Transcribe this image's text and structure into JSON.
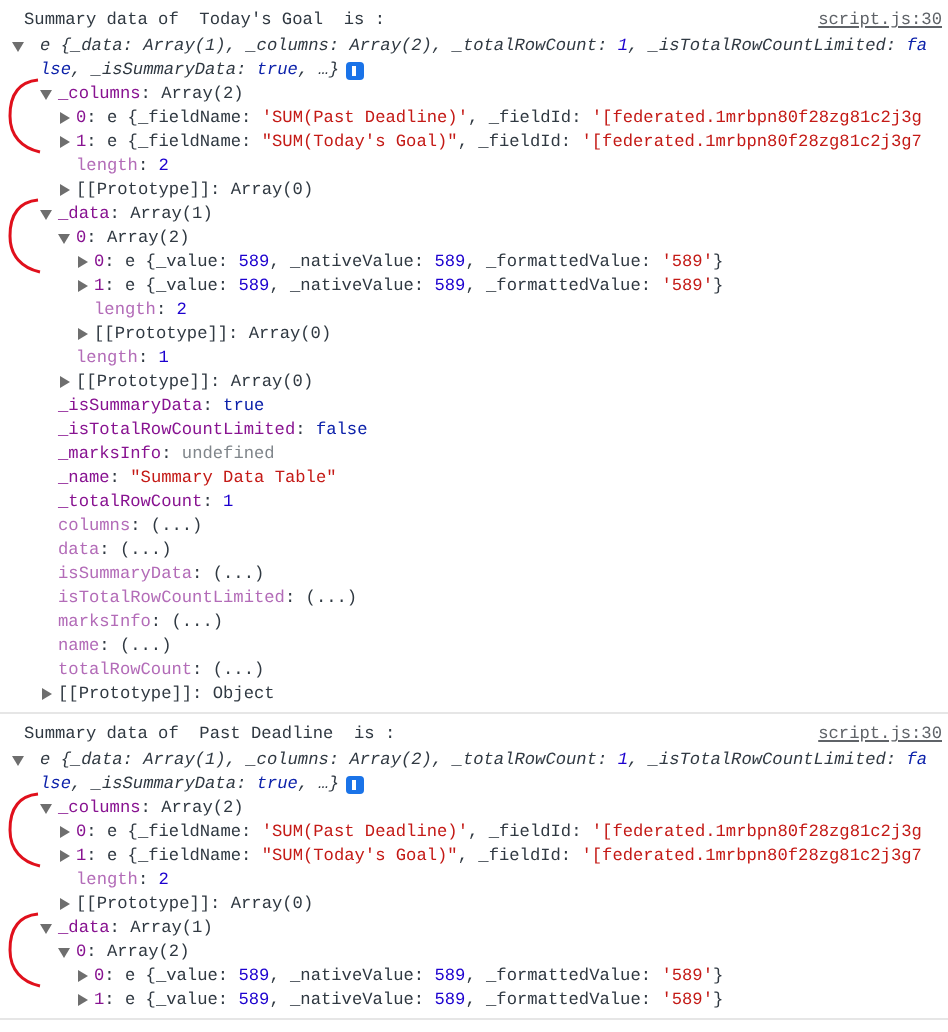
{
  "messages": [
    {
      "header": "Summary data of  Today's Goal  is :",
      "source": "script.js:30",
      "root": {
        "kind": "expandable",
        "expanded": true,
        "preview": true,
        "info_badge": true,
        "tokens": [
          {
            "kind": "text",
            "text": "e {_data: Array(1), _columns: Array(2), _totalRowCount: "
          },
          {
            "kind": "number",
            "text": "1"
          },
          {
            "kind": "text",
            "text": ", _isTotalRowCountLimited: "
          },
          {
            "kind": "keyword",
            "text": "fa"
          },
          {
            "kind": "break"
          },
          {
            "kind": "keyword",
            "text": "lse"
          },
          {
            "kind": "text",
            "text": ", _isSummaryData: "
          },
          {
            "kind": "keyword",
            "text": "true"
          },
          {
            "kind": "text",
            "text": ", …}"
          }
        ],
        "children": [
          {
            "kind": "expandable",
            "expanded": true,
            "annotated": true,
            "tokens": [
              {
                "kind": "key",
                "text": "_columns"
              },
              {
                "kind": "text",
                "text": ": Array(2)"
              }
            ],
            "children": [
              {
                "kind": "expandable",
                "expanded": false,
                "tokens": [
                  {
                    "kind": "key",
                    "text": "0"
                  },
                  {
                    "kind": "text",
                    "text": ": e {_fieldName: "
                  },
                  {
                    "kind": "string",
                    "text": "'SUM(Past Deadline)'"
                  },
                  {
                    "kind": "text",
                    "text": ", _fieldId: "
                  },
                  {
                    "kind": "string",
                    "text": "'[federated.1mrbpn80f28zg81c2j3g"
                  }
                ]
              },
              {
                "kind": "expandable",
                "expanded": false,
                "tokens": [
                  {
                    "kind": "key",
                    "text": "1"
                  },
                  {
                    "kind": "text",
                    "text": ": e {_fieldName: "
                  },
                  {
                    "kind": "string",
                    "text": "\"SUM(Today's Goal)\""
                  },
                  {
                    "kind": "text",
                    "text": ", _fieldId: "
                  },
                  {
                    "kind": "string",
                    "text": "'[federated.1mrbpn80f28zg81c2j3g7"
                  }
                ]
              },
              {
                "kind": "leaf",
                "tokens": [
                  {
                    "kind": "faint-key",
                    "text": "length"
                  },
                  {
                    "kind": "text",
                    "text": ": "
                  },
                  {
                    "kind": "number",
                    "text": "2"
                  }
                ]
              },
              {
                "kind": "expandable",
                "expanded": false,
                "tokens": [
                  {
                    "kind": "text",
                    "text": "[[Prototype]]: Array(0)"
                  }
                ]
              }
            ]
          },
          {
            "kind": "expandable",
            "expanded": true,
            "annotated": true,
            "tokens": [
              {
                "kind": "key",
                "text": "_data"
              },
              {
                "kind": "text",
                "text": ": Array(1)"
              }
            ],
            "children": [
              {
                "kind": "expandable",
                "expanded": true,
                "tokens": [
                  {
                    "kind": "key",
                    "text": "0"
                  },
                  {
                    "kind": "text",
                    "text": ": Array(2)"
                  }
                ],
                "children": [
                  {
                    "kind": "expandable",
                    "expanded": false,
                    "tokens": [
                      {
                        "kind": "key",
                        "text": "0"
                      },
                      {
                        "kind": "text",
                        "text": ": e {_value: "
                      },
                      {
                        "kind": "number",
                        "text": "589"
                      },
                      {
                        "kind": "text",
                        "text": ", _nativeValue: "
                      },
                      {
                        "kind": "number",
                        "text": "589"
                      },
                      {
                        "kind": "text",
                        "text": ", _formattedValue: "
                      },
                      {
                        "kind": "string",
                        "text": "'589'"
                      },
                      {
                        "kind": "text",
                        "text": "}"
                      }
                    ]
                  },
                  {
                    "kind": "expandable",
                    "expanded": false,
                    "tokens": [
                      {
                        "kind": "key",
                        "text": "1"
                      },
                      {
                        "kind": "text",
                        "text": ": e {_value: "
                      },
                      {
                        "kind": "number",
                        "text": "589"
                      },
                      {
                        "kind": "text",
                        "text": ", _nativeValue: "
                      },
                      {
                        "kind": "number",
                        "text": "589"
                      },
                      {
                        "kind": "text",
                        "text": ", _formattedValue: "
                      },
                      {
                        "kind": "string",
                        "text": "'589'"
                      },
                      {
                        "kind": "text",
                        "text": "}"
                      }
                    ]
                  },
                  {
                    "kind": "leaf",
                    "tokens": [
                      {
                        "kind": "faint-key",
                        "text": "length"
                      },
                      {
                        "kind": "text",
                        "text": ": "
                      },
                      {
                        "kind": "number",
                        "text": "2"
                      }
                    ]
                  },
                  {
                    "kind": "expandable",
                    "expanded": false,
                    "tokens": [
                      {
                        "kind": "text",
                        "text": "[[Prototype]]: Array(0)"
                      }
                    ]
                  }
                ]
              },
              {
                "kind": "leaf",
                "tokens": [
                  {
                    "kind": "faint-key",
                    "text": "length"
                  },
                  {
                    "kind": "text",
                    "text": ": "
                  },
                  {
                    "kind": "number",
                    "text": "1"
                  }
                ]
              },
              {
                "kind": "expandable",
                "expanded": false,
                "tokens": [
                  {
                    "kind": "text",
                    "text": "[[Prototype]]: Array(0)"
                  }
                ]
              }
            ]
          },
          {
            "kind": "leaf",
            "tokens": [
              {
                "kind": "key",
                "text": "_isSummaryData"
              },
              {
                "kind": "text",
                "text": ": "
              },
              {
                "kind": "keyword",
                "text": "true"
              }
            ]
          },
          {
            "kind": "leaf",
            "tokens": [
              {
                "kind": "key",
                "text": "_isTotalRowCountLimited"
              },
              {
                "kind": "text",
                "text": ": "
              },
              {
                "kind": "keyword",
                "text": "false"
              }
            ]
          },
          {
            "kind": "leaf",
            "tokens": [
              {
                "kind": "key",
                "text": "_marksInfo"
              },
              {
                "kind": "text",
                "text": ": "
              },
              {
                "kind": "undefined",
                "text": "undefined"
              }
            ]
          },
          {
            "kind": "leaf",
            "tokens": [
              {
                "kind": "key",
                "text": "_name"
              },
              {
                "kind": "text",
                "text": ": "
              },
              {
                "kind": "string",
                "text": "\"Summary Data Table\""
              }
            ]
          },
          {
            "kind": "leaf",
            "tokens": [
              {
                "kind": "key",
                "text": "_totalRowCount"
              },
              {
                "kind": "text",
                "text": ": "
              },
              {
                "kind": "number",
                "text": "1"
              }
            ]
          },
          {
            "kind": "leaf",
            "tokens": [
              {
                "kind": "faint-key",
                "text": "columns"
              },
              {
                "kind": "text",
                "text": ": (...)"
              }
            ]
          },
          {
            "kind": "leaf",
            "tokens": [
              {
                "kind": "faint-key",
                "text": "data"
              },
              {
                "kind": "text",
                "text": ": (...)"
              }
            ]
          },
          {
            "kind": "leaf",
            "tokens": [
              {
                "kind": "faint-key",
                "text": "isSummaryData"
              },
              {
                "kind": "text",
                "text": ": (...)"
              }
            ]
          },
          {
            "kind": "leaf",
            "tokens": [
              {
                "kind": "faint-key",
                "text": "isTotalRowCountLimited"
              },
              {
                "kind": "text",
                "text": ": (...)"
              }
            ]
          },
          {
            "kind": "leaf",
            "tokens": [
              {
                "kind": "faint-key",
                "text": "marksInfo"
              },
              {
                "kind": "text",
                "text": ": (...)"
              }
            ]
          },
          {
            "kind": "leaf",
            "tokens": [
              {
                "kind": "faint-key",
                "text": "name"
              },
              {
                "kind": "text",
                "text": ": (...)"
              }
            ]
          },
          {
            "kind": "leaf",
            "tokens": [
              {
                "kind": "faint-key",
                "text": "totalRowCount"
              },
              {
                "kind": "text",
                "text": ": (...)"
              }
            ]
          },
          {
            "kind": "expandable",
            "expanded": false,
            "tokens": [
              {
                "kind": "text",
                "text": "[[Prototype]]: Object"
              }
            ]
          }
        ]
      }
    },
    {
      "header": "Summary data of  Past Deadline  is :",
      "source": "script.js:30",
      "root": {
        "kind": "expandable",
        "expanded": true,
        "preview": true,
        "info_badge": true,
        "tokens": [
          {
            "kind": "text",
            "text": "e {_data: Array(1), _columns: Array(2), _totalRowCount: "
          },
          {
            "kind": "number",
            "text": "1"
          },
          {
            "kind": "text",
            "text": ", _isTotalRowCountLimited: "
          },
          {
            "kind": "keyword",
            "text": "fa"
          },
          {
            "kind": "break"
          },
          {
            "kind": "keyword",
            "text": "lse"
          },
          {
            "kind": "text",
            "text": ", _isSummaryData: "
          },
          {
            "kind": "keyword",
            "text": "true"
          },
          {
            "kind": "text",
            "text": ", …}"
          }
        ],
        "children": [
          {
            "kind": "expandable",
            "expanded": true,
            "annotated": true,
            "tokens": [
              {
                "kind": "key",
                "text": "_columns"
              },
              {
                "kind": "text",
                "text": ": Array(2)"
              }
            ],
            "children": [
              {
                "kind": "expandable",
                "expanded": false,
                "tokens": [
                  {
                    "kind": "key",
                    "text": "0"
                  },
                  {
                    "kind": "text",
                    "text": ": e {_fieldName: "
                  },
                  {
                    "kind": "string",
                    "text": "'SUM(Past Deadline)'"
                  },
                  {
                    "kind": "text",
                    "text": ", _fieldId: "
                  },
                  {
                    "kind": "string",
                    "text": "'[federated.1mrbpn80f28zg81c2j3g"
                  }
                ]
              },
              {
                "kind": "expandable",
                "expanded": false,
                "tokens": [
                  {
                    "kind": "key",
                    "text": "1"
                  },
                  {
                    "kind": "text",
                    "text": ": e {_fieldName: "
                  },
                  {
                    "kind": "string",
                    "text": "\"SUM(Today's Goal)\""
                  },
                  {
                    "kind": "text",
                    "text": ", _fieldId: "
                  },
                  {
                    "kind": "string",
                    "text": "'[federated.1mrbpn80f28zg81c2j3g7"
                  }
                ]
              },
              {
                "kind": "leaf",
                "tokens": [
                  {
                    "kind": "faint-key",
                    "text": "length"
                  },
                  {
                    "kind": "text",
                    "text": ": "
                  },
                  {
                    "kind": "number",
                    "text": "2"
                  }
                ]
              },
              {
                "kind": "expandable",
                "expanded": false,
                "tokens": [
                  {
                    "kind": "text",
                    "text": "[[Prototype]]: Array(0)"
                  }
                ]
              }
            ]
          },
          {
            "kind": "expandable",
            "expanded": true,
            "annotated": true,
            "tokens": [
              {
                "kind": "key",
                "text": "_data"
              },
              {
                "kind": "text",
                "text": ": Array(1)"
              }
            ],
            "children": [
              {
                "kind": "expandable",
                "expanded": true,
                "tokens": [
                  {
                    "kind": "key",
                    "text": "0"
                  },
                  {
                    "kind": "text",
                    "text": ": Array(2)"
                  }
                ],
                "children": [
                  {
                    "kind": "expandable",
                    "expanded": false,
                    "tokens": [
                      {
                        "kind": "key",
                        "text": "0"
                      },
                      {
                        "kind": "text",
                        "text": ": e {_value: "
                      },
                      {
                        "kind": "number",
                        "text": "589"
                      },
                      {
                        "kind": "text",
                        "text": ", _nativeValue: "
                      },
                      {
                        "kind": "number",
                        "text": "589"
                      },
                      {
                        "kind": "text",
                        "text": ", _formattedValue: "
                      },
                      {
                        "kind": "string",
                        "text": "'589'"
                      },
                      {
                        "kind": "text",
                        "text": "}"
                      }
                    ]
                  },
                  {
                    "kind": "expandable",
                    "expanded": false,
                    "tokens": [
                      {
                        "kind": "key",
                        "text": "1"
                      },
                      {
                        "kind": "text",
                        "text": ": e {_value: "
                      },
                      {
                        "kind": "number",
                        "text": "589"
                      },
                      {
                        "kind": "text",
                        "text": ", _nativeValue: "
                      },
                      {
                        "kind": "number",
                        "text": "589"
                      },
                      {
                        "kind": "text",
                        "text": ", _formattedValue: "
                      },
                      {
                        "kind": "string",
                        "text": "'589'"
                      },
                      {
                        "kind": "text",
                        "text": "}"
                      }
                    ]
                  }
                ]
              }
            ]
          }
        ]
      }
    }
  ]
}
